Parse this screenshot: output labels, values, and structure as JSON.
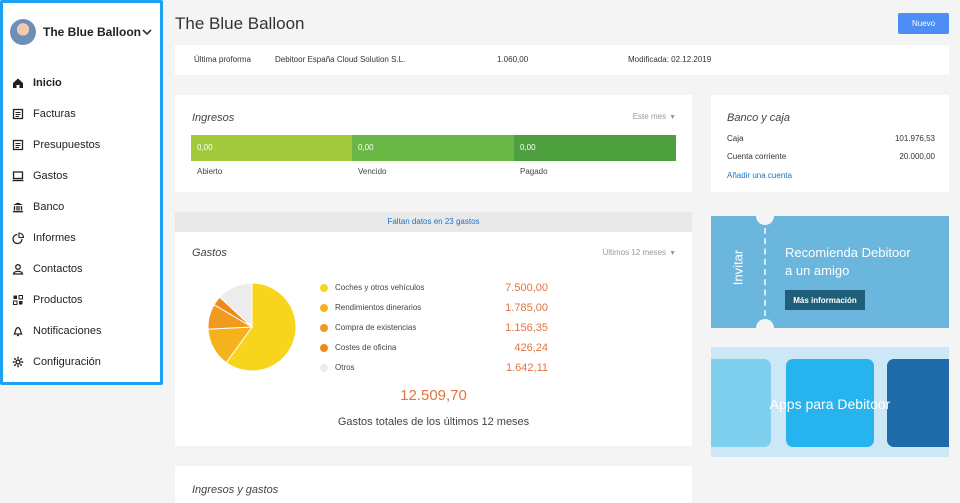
{
  "sidebar": {
    "company": "The Blue Balloon",
    "items": [
      {
        "label": "Inicio",
        "icon": "home-icon",
        "active": true
      },
      {
        "label": "Facturas",
        "icon": "invoice-icon"
      },
      {
        "label": "Presupuestos",
        "icon": "quote-icon"
      },
      {
        "label": "Gastos",
        "icon": "expenses-icon"
      },
      {
        "label": "Banco",
        "icon": "bank-icon"
      },
      {
        "label": "Informes",
        "icon": "reports-icon"
      },
      {
        "label": "Contactos",
        "icon": "contacts-icon"
      },
      {
        "label": "Productos",
        "icon": "products-icon"
      },
      {
        "label": "Notificaciones",
        "icon": "bell-icon"
      },
      {
        "label": "Configuración",
        "icon": "gear-icon"
      }
    ]
  },
  "header": {
    "title": "The Blue Balloon",
    "new_button": "Nuevo"
  },
  "proforma": {
    "label": "Última proforma",
    "client": "Debitoor España Cloud Solution S.L.",
    "amount": "1.060,00",
    "modified": "Modificada: 02.12.2019"
  },
  "ingresos": {
    "title": "Ingresos",
    "period": "Este mes",
    "segments": [
      {
        "label": "Abierto",
        "value": "0,00",
        "color": "#a2c83c"
      },
      {
        "label": "Vencido",
        "value": "0,00",
        "color": "#69b744"
      },
      {
        "label": "Pagado",
        "value": "0,00",
        "color": "#4ea03f"
      }
    ]
  },
  "banco": {
    "title": "Banco y caja",
    "rows": [
      {
        "label": "Caja",
        "value": "101.976,53"
      },
      {
        "label": "Cuenta corriente",
        "value": "20.000,00"
      }
    ],
    "add_link": "Añadir una cuenta"
  },
  "notice": "Faltan datos en 23 gastos",
  "gastos": {
    "title": "Gastos",
    "period": "Últimos 12 meses",
    "total": "12.509,70",
    "subtitle": "Gastos totales de los últimos 12 meses"
  },
  "chart_data": {
    "type": "pie",
    "categories": [
      "Coches y otros vehículos",
      "Rendimientos dinerarios",
      "Compra de existencias",
      "Costes de oficina",
      "Otros"
    ],
    "values": [
      7500.0,
      1785.0,
      1156.35,
      426.24,
      1642.11
    ],
    "labels": [
      "7.500,00",
      "1.785,00",
      "1.156,35",
      "426,24",
      "1.642,11"
    ],
    "colors": [
      "#f7d51c",
      "#f5b21b",
      "#f29a1f",
      "#ef8a1a",
      "#ececec"
    ]
  },
  "recomienda": {
    "side_label": "Invitar",
    "line1": "Recomienda Debitoor",
    "line2": "a un amigo",
    "button": "Más información"
  },
  "apps": {
    "title": "Apps para Debitoor",
    "tile_colors": [
      "#7fd0ee",
      "#27b3ee",
      "#1f6aa8"
    ]
  },
  "ingresos_gastos": {
    "title": "Ingresos y gastos"
  },
  "colors": {
    "accent": "#1da1f2",
    "primary_button": "#4c8df6",
    "link": "#1a73c8",
    "amount": "#e07540"
  }
}
